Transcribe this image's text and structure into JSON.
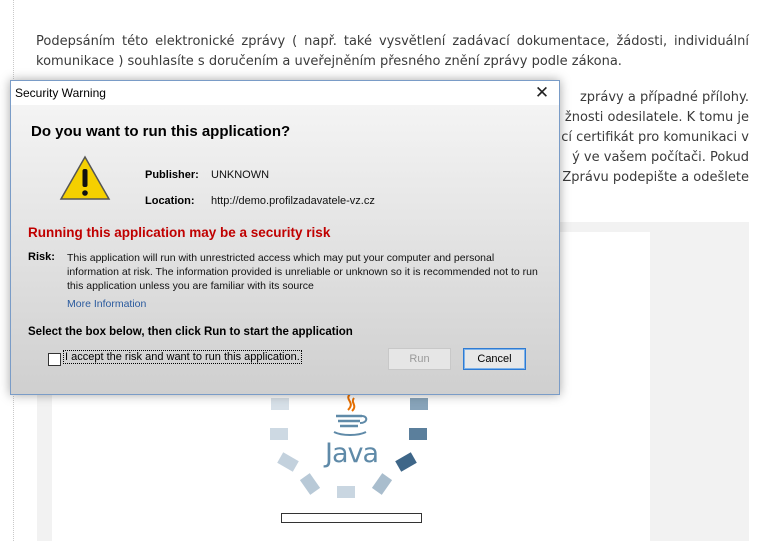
{
  "page": {
    "paragraph1": "Podepsáním této elektronické zprávy ( např. také vysvětlení zadávací dokumentace, žádosti, individuální komunikace ) souhlasíte s doručením a uveřejněním přesného znění zprávy podle zákona.",
    "paragraph2_lines": [
      "zprávy a případné přílohy.",
      "žnosti odesilatele. K tomu je",
      "cí certifikát pro komunikaci v",
      "ý ve vašem počítači. Pokud",
      "Zprávu podepište a odešlete"
    ],
    "java_logo_text": "Java"
  },
  "dialog": {
    "title": "Security Warning",
    "heading": "Do you want to run this application?",
    "publisher_label": "Publisher:",
    "publisher_value": "UNKNOWN",
    "location_label": "Location:",
    "location_value": "http://demo.profilzadavatele-vz.cz",
    "risk_title": "Running this application may be a security risk",
    "risk_label": "Risk:",
    "risk_text": "This application will run with unrestricted access which may put your computer and personal information at risk. The information provided is unreliable or unknown so it is recommended not to run this application unless you are familiar with its source",
    "more_info": "More Information",
    "instruction": "Select the box below, then click Run to start the application",
    "checkbox_label": "I accept the risk and want to run this application.",
    "checkbox_checked": false,
    "run_label": "Run",
    "cancel_label": "Cancel",
    "icons": [
      "warning-icon",
      "close-icon"
    ],
    "colors": {
      "risk_title": "#c00000",
      "link": "#2a5a9e",
      "focus": "#2f7bd3"
    }
  }
}
